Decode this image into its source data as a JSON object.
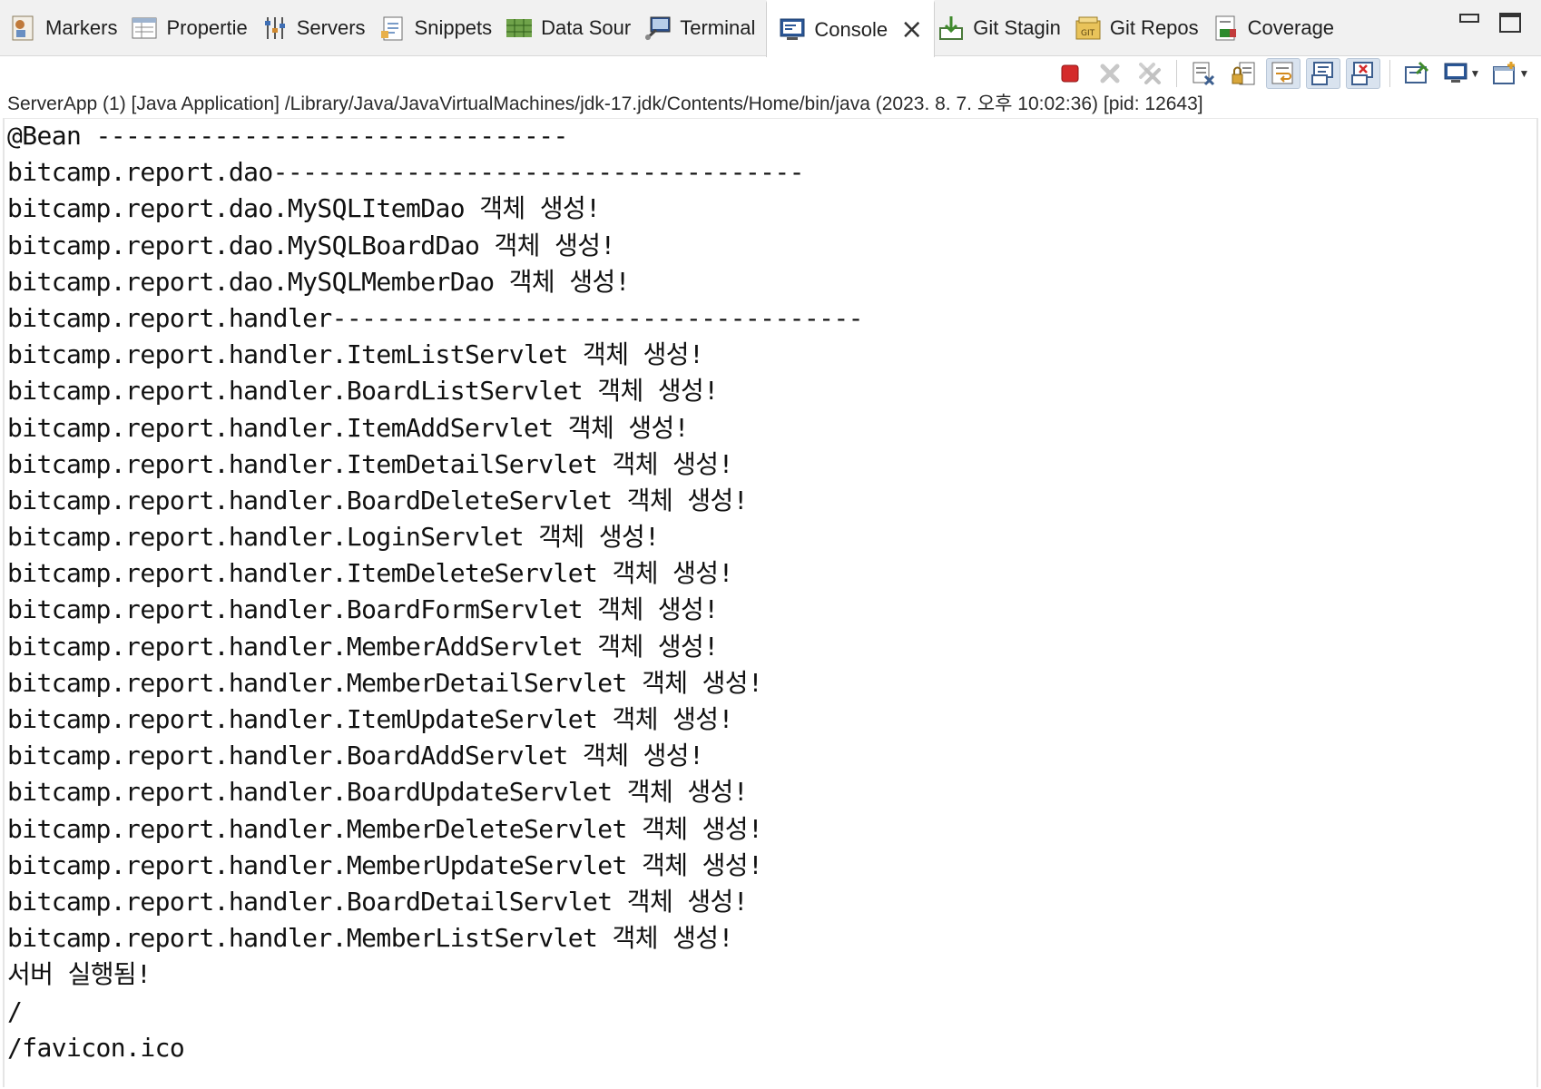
{
  "tabs": [
    {
      "label": "Markers",
      "icon": "markers-icon"
    },
    {
      "label": "Propertie",
      "icon": "properties-icon"
    },
    {
      "label": "Servers",
      "icon": "servers-icon"
    },
    {
      "label": "Snippets",
      "icon": "snippets-icon"
    },
    {
      "label": "Data Sour",
      "icon": "data-source-icon"
    },
    {
      "label": "Terminal",
      "icon": "terminal-icon"
    },
    {
      "label": "Console",
      "icon": "console-icon",
      "active": true
    },
    {
      "label": "Git Stagin",
      "icon": "git-staging-icon"
    },
    {
      "label": "Git Repos",
      "icon": "git-repos-icon"
    },
    {
      "label": "Coverage",
      "icon": "coverage-icon"
    }
  ],
  "toolbar": {
    "buttons": [
      "terminate-icon",
      "remove-launch-icon",
      "remove-all-launches-icon",
      "clear-console-icon",
      "scroll-lock-icon",
      "word-wrap-icon",
      "show-on-stdout-icon",
      "show-on-stderr-icon",
      "pin-console-icon",
      "display-selected-console-icon",
      "open-console-icon"
    ]
  },
  "process_line": "ServerApp (1) [Java Application] /Library/Java/JavaVirtualMachines/jdk-17.jdk/Contents/Home/bin/java  (2023. 8. 7. 오후 10:02:36) [pid: 12643]",
  "console_lines": [
    "@Bean --------------------------------",
    "bitcamp.report.dao------------------------------------",
    "bitcamp.report.dao.MySQLItemDao 객체 생성!",
    "bitcamp.report.dao.MySQLBoardDao 객체 생성!",
    "bitcamp.report.dao.MySQLMemberDao 객체 생성!",
    "bitcamp.report.handler------------------------------------",
    "bitcamp.report.handler.ItemListServlet 객체 생성!",
    "bitcamp.report.handler.BoardListServlet 객체 생성!",
    "bitcamp.report.handler.ItemAddServlet 객체 생성!",
    "bitcamp.report.handler.ItemDetailServlet 객체 생성!",
    "bitcamp.report.handler.BoardDeleteServlet 객체 생성!",
    "bitcamp.report.handler.LoginServlet 객체 생성!",
    "bitcamp.report.handler.ItemDeleteServlet 객체 생성!",
    "bitcamp.report.handler.BoardFormServlet 객체 생성!",
    "bitcamp.report.handler.MemberAddServlet 객체 생성!",
    "bitcamp.report.handler.MemberDetailServlet 객체 생성!",
    "bitcamp.report.handler.ItemUpdateServlet 객체 생성!",
    "bitcamp.report.handler.BoardAddServlet 객체 생성!",
    "bitcamp.report.handler.BoardUpdateServlet 객체 생성!",
    "bitcamp.report.handler.MemberDeleteServlet 객체 생성!",
    "bitcamp.report.handler.MemberUpdateServlet 객체 생성!",
    "bitcamp.report.handler.BoardDetailServlet 객체 생성!",
    "bitcamp.report.handler.MemberListServlet 객체 생성!",
    "서버 실행됨!",
    "/",
    "/favicon.ico"
  ]
}
